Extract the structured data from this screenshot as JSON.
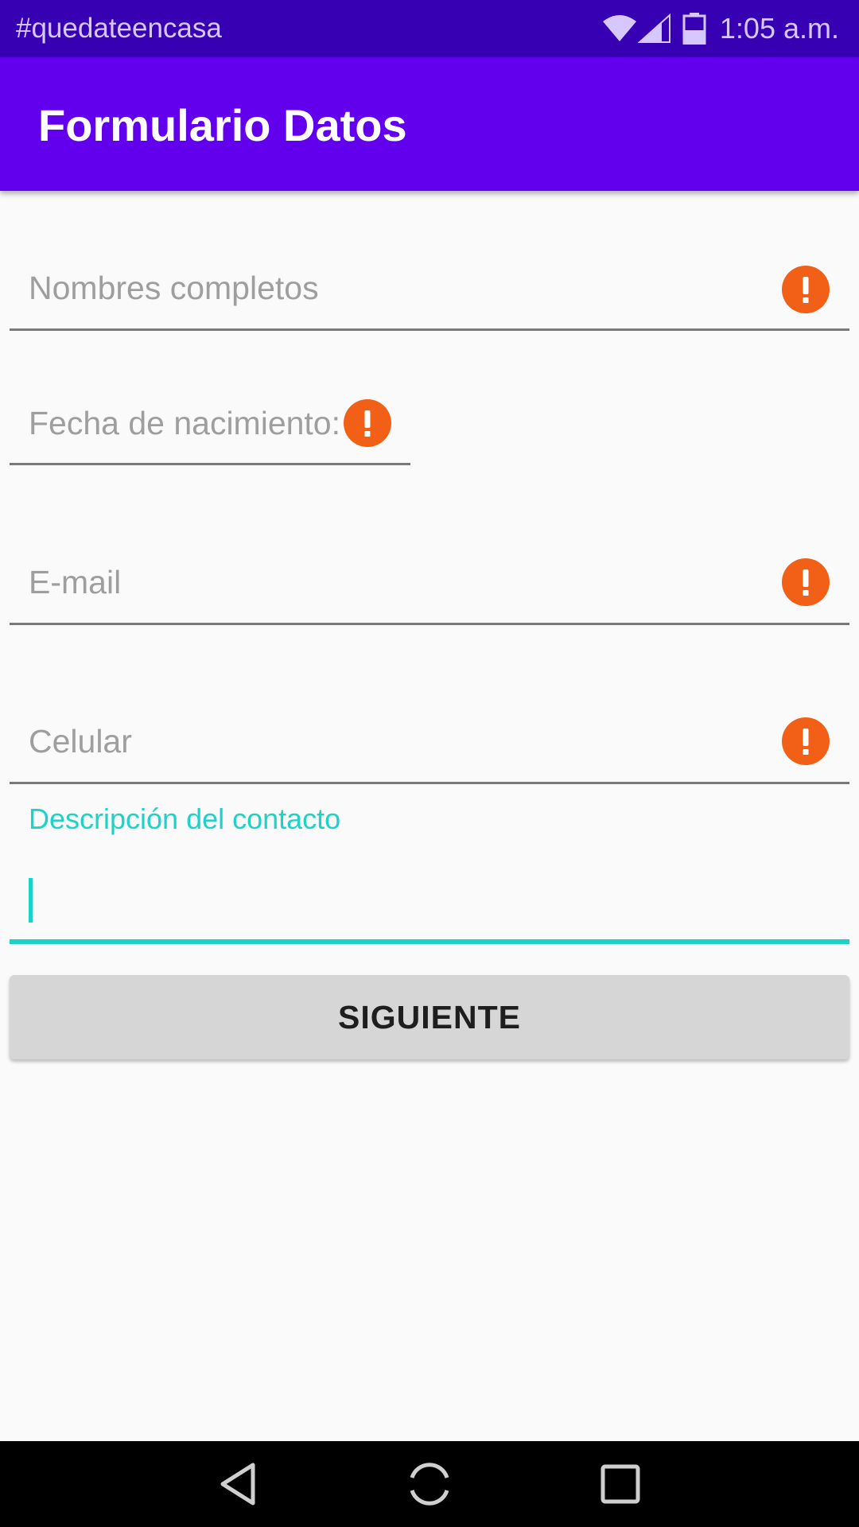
{
  "status_bar": {
    "carrier_text": "#quedateencasa",
    "time": "1:05 a.m.",
    "icons": [
      "wifi-icon",
      "cell-signal-icon",
      "battery-icon"
    ]
  },
  "app_bar": {
    "title": "Formulario Datos"
  },
  "form": {
    "full_name": {
      "placeholder": "Nombres completos",
      "value": "",
      "error_icon": "error-alert-icon"
    },
    "birth_date": {
      "placeholder": "Fecha de nacimiento:",
      "value": "",
      "error_icon": "error-alert-icon"
    },
    "email": {
      "placeholder": "E-mail",
      "value": "",
      "error_icon": "error-alert-icon"
    },
    "phone": {
      "placeholder": "Celular",
      "value": "",
      "error_icon": "error-alert-icon"
    },
    "description": {
      "label": "Descripción del contacto",
      "value": ""
    }
  },
  "next_button": {
    "label": "SIGUIENTE"
  },
  "nav_bar": {
    "icons": [
      "back-icon",
      "home-icon",
      "recents-icon"
    ]
  },
  "colors": {
    "status_bar": "#3700b3",
    "app_bar": "#6200ee",
    "accent": "#1dd3c8",
    "error": "#f26018",
    "background": "#fafafa"
  }
}
